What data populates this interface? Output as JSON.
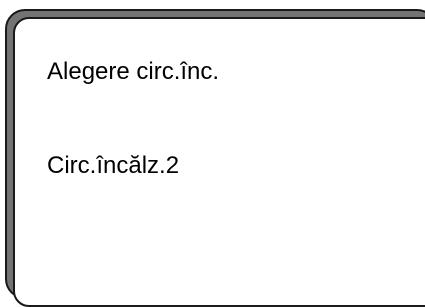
{
  "display": {
    "title": "Alegere circ.înc.",
    "value": "Circ.încălz.2"
  },
  "colors": {
    "bezel": "#737373",
    "screen": "#ffffff",
    "outline": "#1a1a1a",
    "text": "#000000"
  }
}
